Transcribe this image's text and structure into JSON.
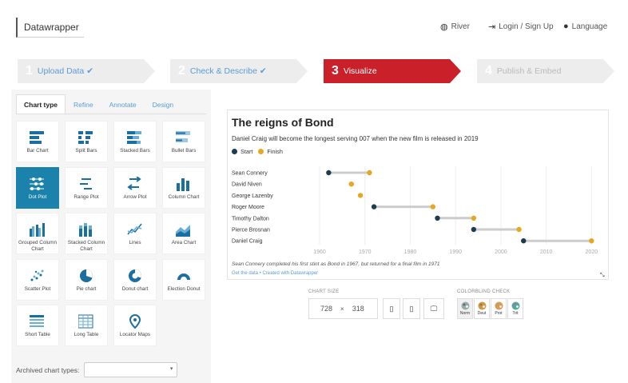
{
  "header": {
    "logo": "Datawrapper",
    "nav": [
      {
        "icon": "palette-icon",
        "label": "River"
      },
      {
        "icon": "login-icon",
        "label": "Login / Sign Up"
      },
      {
        "icon": "globe-icon",
        "label": "Language"
      }
    ]
  },
  "steps": [
    {
      "num": "1",
      "label": "Upload Data ✔",
      "state": "done"
    },
    {
      "num": "2",
      "label": "Check & Describe ✔",
      "state": "done"
    },
    {
      "num": "3",
      "label": "Visualize",
      "state": "active"
    },
    {
      "num": "4",
      "label": "Publish & Embed",
      "state": "inactive"
    }
  ],
  "tabs": [
    "Chart type",
    "Refine",
    "Annotate",
    "Design"
  ],
  "chart_types": [
    {
      "label": "Bar Chart",
      "icon": "bar-chart-icon"
    },
    {
      "label": "Split Bars",
      "icon": "split-bars-icon"
    },
    {
      "label": "Stacked Bars",
      "icon": "stacked-bars-icon"
    },
    {
      "label": "Bullet Bars",
      "icon": "bullet-bars-icon"
    },
    {
      "label": "Dot Plot",
      "icon": "dot-plot-icon",
      "selected": true
    },
    {
      "label": "Range Plot",
      "icon": "range-plot-icon"
    },
    {
      "label": "Arrow Plot",
      "icon": "arrow-plot-icon"
    },
    {
      "label": "Column Chart",
      "icon": "column-chart-icon"
    },
    {
      "label": "Grouped Column Chart",
      "icon": "grouped-column-icon"
    },
    {
      "label": "Stacked Column Chart",
      "icon": "stacked-column-icon"
    },
    {
      "label": "Lines",
      "icon": "lines-icon"
    },
    {
      "label": "Area Chart",
      "icon": "area-chart-icon"
    },
    {
      "label": "Scatter Plot",
      "icon": "scatter-plot-icon"
    },
    {
      "label": "Pie chart",
      "icon": "pie-chart-icon"
    },
    {
      "label": "Donut chart",
      "icon": "donut-chart-icon"
    },
    {
      "label": "Election Donut",
      "icon": "election-donut-icon"
    },
    {
      "label": "Short Table",
      "icon": "short-table-icon"
    },
    {
      "label": "Long Table",
      "icon": "long-table-icon"
    },
    {
      "label": "Locator Maps",
      "icon": "locator-map-icon"
    }
  ],
  "archived": {
    "label": "Archived chart types:",
    "value": ""
  },
  "chart": {
    "title": "The reigns of Bond",
    "subtitle": "Daniel Craig will become the longest serving 007 when the new film is released in 2019",
    "legend": [
      {
        "label": "Start",
        "color": "#1d3c4f"
      },
      {
        "label": "Finish",
        "color": "#e6a822"
      }
    ],
    "note": "Sean Connery completed his first stint as Bond in 1967, but returned for a final film in 1971",
    "credit": "Get the data • Created with Datawrapper"
  },
  "chart_data": {
    "type": "dot-range",
    "categories": [
      "Sean Connery",
      "David Niven",
      "George Lazenby",
      "Roger Moore",
      "Timothy Dalton",
      "Pierce Brosnan",
      "Daniel Craig"
    ],
    "series": [
      {
        "name": "Start",
        "values": [
          1962,
          null,
          null,
          1972,
          1986,
          1994,
          2005
        ]
      },
      {
        "name": "Finish",
        "values": [
          1971,
          1967,
          1969,
          1985,
          1994,
          2004,
          2020
        ]
      }
    ],
    "xticks": [
      1960,
      1970,
      1980,
      1990,
      2000,
      2010,
      2020
    ],
    "xlim": [
      1951,
      2021
    ],
    "grid": true,
    "legend_position": "top-left"
  },
  "controls": {
    "chart_size_label": "CHART SIZE",
    "width": "728",
    "times": "×",
    "height": "318",
    "colorblind_label": "COLORBLIND CHECK",
    "colorblind_modes": [
      "Norm",
      "Deut",
      "Prot",
      "Trit"
    ]
  },
  "colors": {
    "accent": "#c9202a",
    "selected": "#1b82ab",
    "start": "#1d3c4f",
    "finish": "#e6a822",
    "link": "#5b9bd5"
  }
}
